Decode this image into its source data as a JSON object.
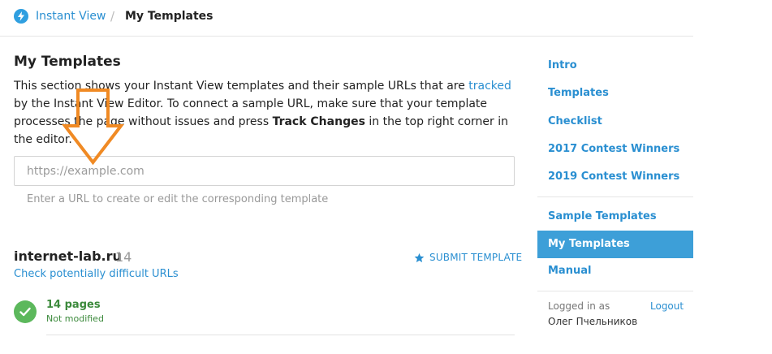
{
  "header": {
    "app_link": "Instant View",
    "separator": "/",
    "current": "My Templates"
  },
  "main": {
    "title": "My Templates",
    "intro_before_link": "This section shows your Instant View templates and their sample URLs that are ",
    "intro_link": "tracked",
    "intro_middle": " by the Instant View Editor. To connect a sample URL, make sure that your template processes the page without issues and press ",
    "intro_bold": "Track Changes",
    "intro_after": " in the top right corner in the editor.",
    "url_input": {
      "placeholder": "https://example.com",
      "value": ""
    },
    "hint": "Enter a URL to create or edit the corresponding template",
    "template": {
      "domain": "internet-lab.ru",
      "count": "14",
      "difficult_link": "Check potentially difficult URLs",
      "submit_label": "SUBMIT TEMPLATE",
      "pages": "14 pages",
      "status": "Not modified"
    }
  },
  "sidebar": {
    "items": [
      "Intro",
      "Templates",
      "Checklist",
      "2017 Contest Winners",
      "2019 Contest Winners"
    ],
    "items2": [
      "Sample Templates",
      "My Templates",
      "Manual"
    ],
    "active": "My Templates",
    "logged_in_as": "Logged in as",
    "logout": "Logout",
    "username": "Олег Пчельников"
  },
  "colors": {
    "accent": "#2a8fd1",
    "active_bg": "#3d9fd8",
    "success": "#5cb85c",
    "annotation_arrow": "#f08a24"
  },
  "icons": [
    "lightning-icon",
    "star-icon",
    "check-icon",
    "down-arrow-annotation-icon"
  ]
}
